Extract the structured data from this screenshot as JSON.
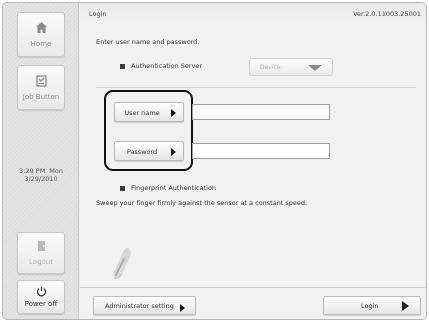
{
  "sidebar": {
    "home": {
      "label": "Home",
      "icon": "home-icon"
    },
    "job_button": {
      "label": "Job Button",
      "icon": "job-button-icon"
    },
    "clock": {
      "time": "3:29 PM  Mon",
      "date": "3/29/2010"
    },
    "logout": {
      "label": "Logout",
      "icon": "logout-icon"
    },
    "power_off": {
      "label": "Power off",
      "icon": "power-icon"
    }
  },
  "header": {
    "title": "Login",
    "version": "Ver.2.0.11003.25001"
  },
  "login": {
    "instruction": "Enter user name and password.",
    "auth_server": {
      "label": "Authentication Server",
      "value": "Device"
    },
    "username": {
      "label": "User name",
      "value": ""
    },
    "password": {
      "label": "Password",
      "value": ""
    },
    "fingerprint": {
      "label": "Fingerprint Authentication",
      "description": "Sweep your finger firmly against the sensor at a constant speed."
    }
  },
  "footer": {
    "admin_label": "Administrator setting",
    "login_label": "Login"
  },
  "colors": {
    "focus_ring": "#111111",
    "background": "#f2f2f2",
    "sidebar": "#e4e4e4"
  }
}
